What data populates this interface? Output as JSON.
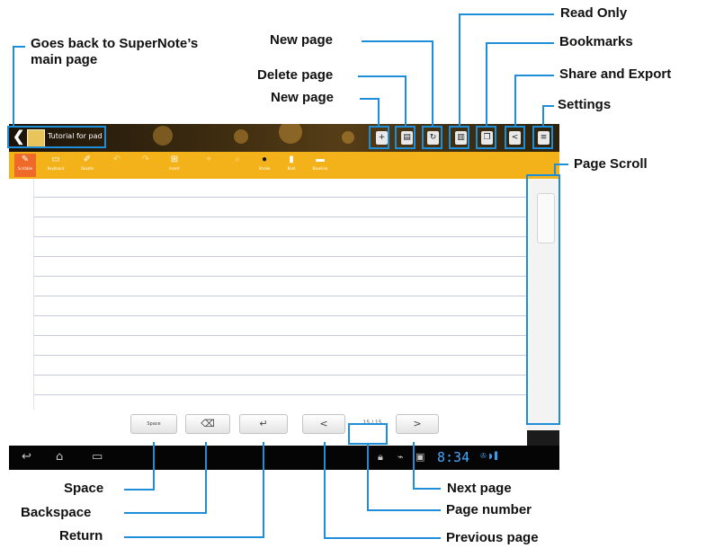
{
  "callouts": {
    "goes_back": "Goes back to SuperNote’s main page",
    "new_page_top": "New page",
    "delete_page": "Delete page",
    "new_page": "New page",
    "read_only": "Read Only",
    "bookmarks": "Bookmarks",
    "share_export": "Share and Export",
    "settings": "Settings",
    "page_scroll": "Page Scroll",
    "space": "Space",
    "backspace": "Backspace",
    "return": "Return",
    "next_page": "Next page",
    "page_number": "Page number",
    "previous_page": "Previous page"
  },
  "app": {
    "note_title": "Tutorial for pad",
    "title_icons": [
      "add-page-icon",
      "delete-page-icon",
      "new-page-icon",
      "read-only-icon",
      "bookmarks-icon",
      "share-icon",
      "settings-icon"
    ]
  },
  "toolbar": {
    "tools": [
      {
        "label": "Scribble",
        "icon": "scribble-icon",
        "state": "active"
      },
      {
        "label": "Keyboard",
        "icon": "keyboard-icon",
        "state": "normal"
      },
      {
        "label": "Doodle",
        "icon": "doodle-icon",
        "state": "normal"
      },
      {
        "label": "",
        "icon": "undo-icon",
        "state": "dim"
      },
      {
        "label": "",
        "icon": "redo-icon",
        "state": "dim"
      },
      {
        "label": "Insert",
        "icon": "insert-icon",
        "state": "normal"
      },
      {
        "label": "",
        "icon": "plus-icon",
        "state": "dim"
      },
      {
        "label": "",
        "icon": "zoom-icon",
        "state": "dim"
      },
      {
        "label": "Stroke",
        "icon": "stroke-dot-icon",
        "state": "normal"
      },
      {
        "label": "Bold",
        "icon": "bold-icon",
        "state": "normal"
      },
      {
        "label": "Baseline",
        "icon": "baseline-icon",
        "state": "normal"
      }
    ]
  },
  "bottom": {
    "space_label": "Space",
    "backspace_glyph": "⌫",
    "return_glyph": "↵",
    "prev_glyph": "<",
    "next_glyph": ">",
    "page_number": "15 / 15"
  },
  "system": {
    "back_glyph": "↩",
    "home_glyph": "⌂",
    "recent_glyph": "▭",
    "clock": "8:34",
    "status_icons": "✇ ◗ ▌"
  },
  "colors": {
    "highlight": "#1f8ed8",
    "toolbar": "#f4b21a",
    "active_tool": "#ef6a28",
    "clock": "#44a7ff"
  }
}
